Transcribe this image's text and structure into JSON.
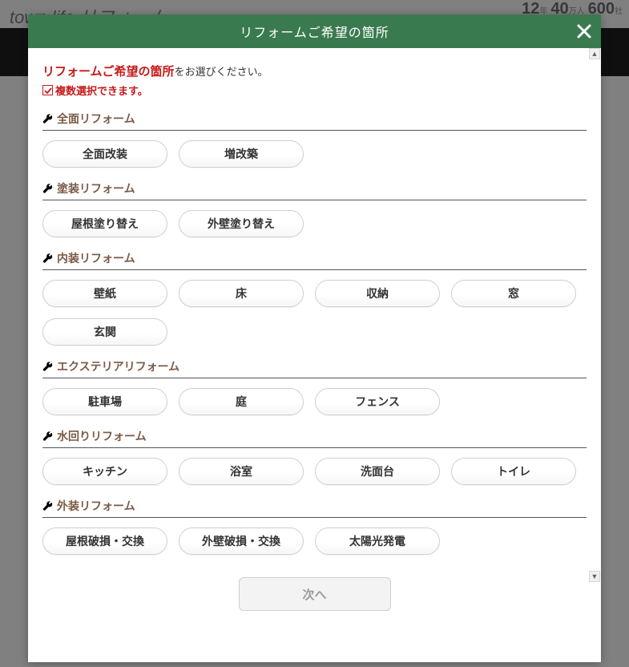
{
  "background": {
    "logo": "town life リフォーム",
    "badges": [
      {
        "num": "12",
        "unit": "年"
      },
      {
        "num": "40",
        "unit": "万人"
      },
      {
        "num": "600",
        "unit": "社"
      }
    ]
  },
  "modal": {
    "title": "リフォームご希望の箇所",
    "prompt_strong": "リフォームご希望の箇所",
    "prompt_rest": "をお選びください。",
    "multi_label": "複数選択できます。",
    "next_label": "次へ",
    "sections": [
      {
        "title": "全面リフォーム",
        "items": [
          "全面改装",
          "増改築"
        ]
      },
      {
        "title": "塗装リフォーム",
        "items": [
          "屋根塗り替え",
          "外壁塗り替え"
        ]
      },
      {
        "title": "内装リフォーム",
        "items": [
          "壁紙",
          "床",
          "収納",
          "窓",
          "玄関"
        ]
      },
      {
        "title": "エクステリアリフォーム",
        "items": [
          "駐車場",
          "庭",
          "フェンス"
        ]
      },
      {
        "title": "水回りリフォーム",
        "items": [
          "キッチン",
          "浴室",
          "洗面台",
          "トイレ"
        ]
      },
      {
        "title": "外装リフォーム",
        "items": [
          "屋根破損・交換",
          "外壁破損・交換",
          "太陽光発電"
        ]
      }
    ]
  }
}
